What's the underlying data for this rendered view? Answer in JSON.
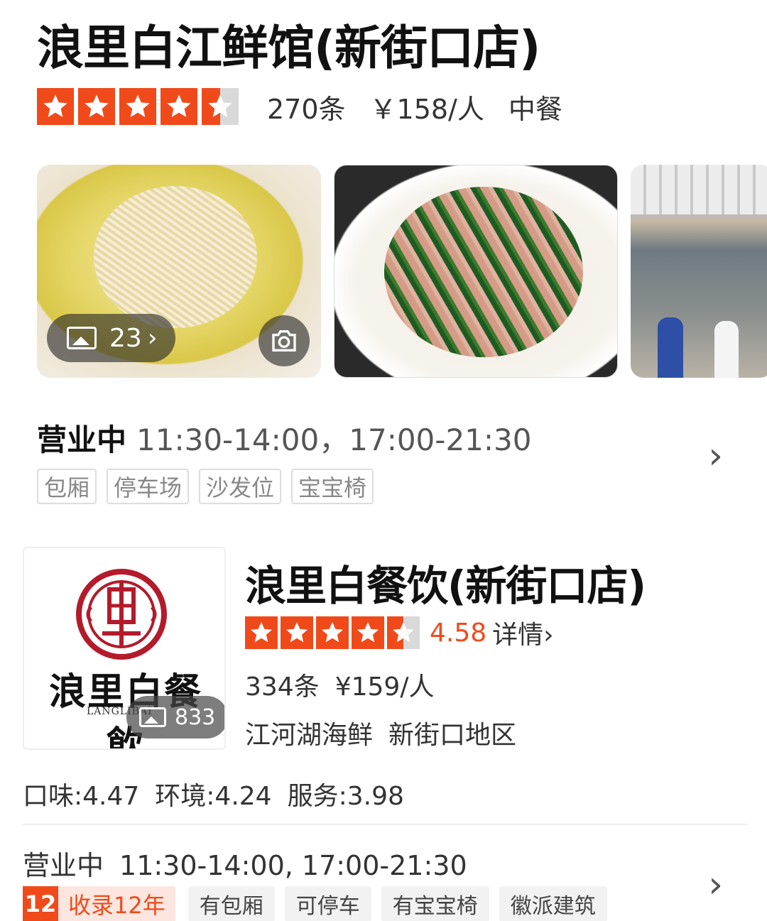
{
  "listing1": {
    "title": "浪里白江鲜馆(新街口店)",
    "rating_stars": 4.5,
    "review_count": "270条",
    "price": "￥158/人",
    "cuisine": "中餐",
    "photo_count": "23",
    "status": "营业中",
    "hours": "11:30-14:00，17:00-21:30",
    "facilities": [
      "包厢",
      "停车场",
      "沙发位",
      "宝宝椅"
    ]
  },
  "listing2": {
    "title": "浪里白餐饮(新街口店)",
    "logo_text": "浪里白餐飲",
    "logo_subtext": "LANGLIBAI",
    "photo_count": "833",
    "rating_stars": 4.5,
    "score": "4.58",
    "detail_label": "详情",
    "review_count": "334条",
    "price": "¥159/人",
    "category": "江河湖海鲜",
    "area": "新街口地区",
    "taste": "口味:4.47",
    "environment": "环境:4.24",
    "service": "服务:3.98",
    "status": "营业中",
    "hours": "11:30-14:00, 17:00-21:30",
    "years_num": "12",
    "years_label": "收录12年",
    "tags": [
      "有包厢",
      "可停车",
      "有宝宝椅",
      "徽派建筑"
    ]
  },
  "icons": {
    "star": "star-icon",
    "photo": "image-icon",
    "camera": "camera-icon",
    "chevron": "chevron-right-icon"
  },
  "colors": {
    "accent": "#f04a1b",
    "star_empty": "#d9d9d9",
    "muted_text": "#888888"
  }
}
